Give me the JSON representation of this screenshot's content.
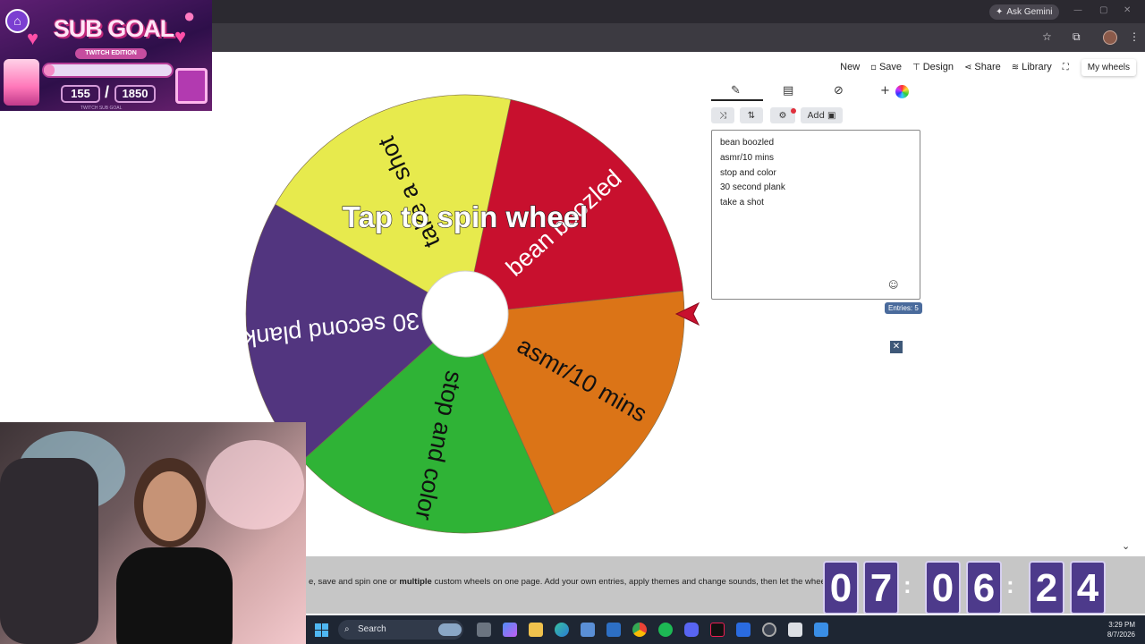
{
  "browser": {
    "gemini_label": "Ask Gemini"
  },
  "subgoal": {
    "title": "SUB GOAL",
    "subtitle": "TWITCH EDITION",
    "current": "155",
    "target": "1850",
    "progress": 0.0838,
    "footer": "TWITCH SUB GOAL"
  },
  "toolbar": {
    "new": "New",
    "save": "Save",
    "design": "Design",
    "share": "Share",
    "library": "Library",
    "my_wheels": "My wheels"
  },
  "wheel": {
    "prompt": "Tap to spin wheel",
    "segments": [
      {
        "label": "bean boozled",
        "color": "#c8102e",
        "text_color": "#ffffff"
      },
      {
        "label": "asmr/10 mins",
        "color": "#db7417",
        "text_color": "#111111"
      },
      {
        "label": "stop and color",
        "color": "#2fb336",
        "text_color": "#111111"
      },
      {
        "label": "30 second plank",
        "color": "#52357f",
        "text_color": "#ffffff"
      },
      {
        "label": "take a shot",
        "color": "#e7ea4d",
        "text_color": "#111111"
      }
    ]
  },
  "editor": {
    "add_label": "Add",
    "entries": [
      "bean boozled",
      "asmr/10 mins",
      "stop and color",
      "30 second plank",
      "take a shot"
    ],
    "entries_count": "Entries: 5"
  },
  "info": {
    "text_before": "e, save and spin one or ",
    "text_bold": "multiple",
    "text_after": " custom wheels on one page. Add your own entries, apply themes and change sounds, then let the wheel deci"
  },
  "timer": {
    "digits": [
      "0",
      "7",
      "0",
      "6",
      "2",
      "4"
    ]
  },
  "taskbar": {
    "search_placeholder": "Search",
    "time": "3:29 PM",
    "date": "8/7/2026"
  }
}
